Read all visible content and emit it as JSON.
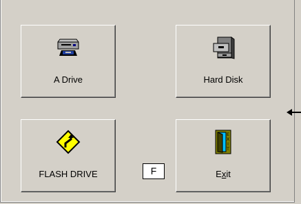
{
  "buttons": {
    "a_drive": {
      "label": "A Drive",
      "icon": "floppy-drive-icon"
    },
    "hard_disk": {
      "label": "Hard Disk",
      "icon": "filing-cabinet-icon"
    },
    "flash_drive": {
      "label": "FLASH DRIVE",
      "icon": "road-sign-icon"
    },
    "exit": {
      "label_pre": "E",
      "label_accel": "x",
      "label_post": "it",
      "icon": "exit-door-icon"
    }
  },
  "drive_letter": "F",
  "pointer": {
    "icon": "left-arrow-icon"
  }
}
